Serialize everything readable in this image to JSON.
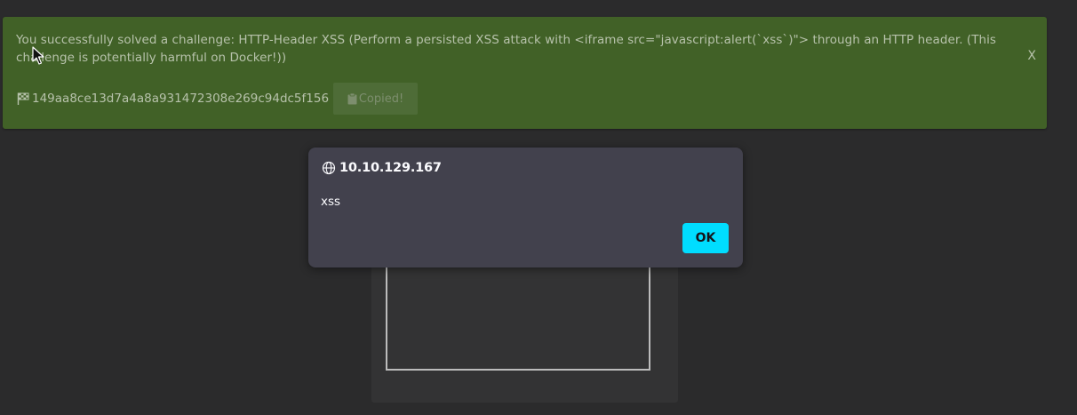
{
  "banner": {
    "message": "You successfully solved a challenge: HTTP-Header XSS (Perform a persisted XSS attack with <iframe src=\"javascript:alert(`xss`)\"> through an HTTP header. (This challenge is potentially harmful on Docker!))",
    "close_label": "X",
    "flag_icon": "checkered-flag-icon",
    "flag_code": "149aa8ce13d7a4a8a931472308e269c94dc5f156",
    "copy_button_label": "Copied!",
    "copy_icon": "clipboard-icon",
    "color": "#416127"
  },
  "alert": {
    "origin_icon": "globe-icon",
    "origin": "10.10.129.167",
    "message": "xss",
    "ok_label": "OK",
    "ok_color": "#00ddff"
  },
  "background": {
    "color": "#2b2b2c"
  }
}
